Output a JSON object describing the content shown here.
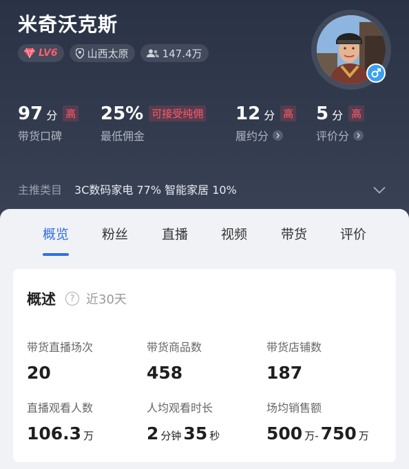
{
  "profile": {
    "name": "米奇沃克斯",
    "level": "LV6",
    "location": "山西太原",
    "followers": "147.4万"
  },
  "stats": [
    {
      "value": "97",
      "unit": "分",
      "badge": "高",
      "label": "带货口碑"
    },
    {
      "value": "25%",
      "unit": "",
      "badge": "可接受纯佣",
      "label": "最低佣金"
    },
    {
      "value": "12",
      "unit": "分",
      "badge": "高",
      "label": "履约分"
    },
    {
      "value": "5",
      "unit": "分",
      "badge": "高",
      "label": "评价分"
    }
  ],
  "category": {
    "label": "主推类目",
    "value": "3C数码家电 77% 智能家居 10%"
  },
  "tabs": [
    "概览",
    "粉丝",
    "直播",
    "视频",
    "带货",
    "评价"
  ],
  "overview": {
    "title": "概述",
    "help": "?",
    "period": "近30天",
    "metrics": [
      {
        "label": "带货直播场次",
        "value": "20"
      },
      {
        "label": "带货商品数",
        "value": "458"
      },
      {
        "label": "带货店铺数",
        "value": "187"
      },
      {
        "label": "直播观看人数",
        "value": "106.3",
        "unit": "万"
      },
      {
        "label": "人均观看时长",
        "v1": "2",
        "u1": "分钟",
        "v2": "35",
        "u2": "秒"
      },
      {
        "label": "场均销售额",
        "v1": "500",
        "u1": "万-",
        "v2": "750",
        "u2": "万"
      }
    ]
  },
  "colors": {
    "header_bg": "#2f384b",
    "accent_blue": "#2f6fe8",
    "badge_red": "#ff5b6a",
    "gender_blue": "#3aa0f3"
  }
}
